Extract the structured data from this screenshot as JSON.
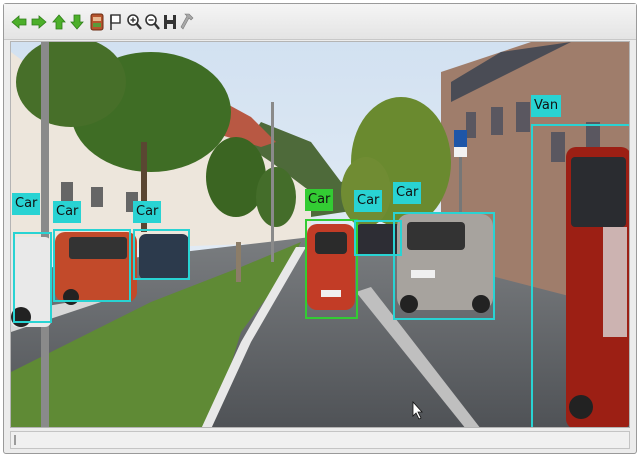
{
  "toolbar": {
    "icons": [
      "arrow-left-icon",
      "arrow-right-icon",
      "arrow-up-icon",
      "arrow-down-icon",
      "database-icon",
      "flag-icon",
      "zoom-in-icon",
      "zoom-out-icon",
      "fit-icon",
      "wrench-icon"
    ]
  },
  "detections": [
    {
      "label": "Car",
      "id": "car-1"
    },
    {
      "label": "Car",
      "id": "car-2"
    },
    {
      "label": "Car",
      "id": "car-3"
    },
    {
      "label": "Car",
      "id": "car-4"
    },
    {
      "label": "Car",
      "id": "car-5"
    },
    {
      "label": "Car",
      "id": "car-6"
    },
    {
      "label": "Van",
      "id": "van-1"
    }
  ],
  "colors": {
    "bbox": "#29d3d3",
    "bbox_selected": "#33cc33"
  }
}
